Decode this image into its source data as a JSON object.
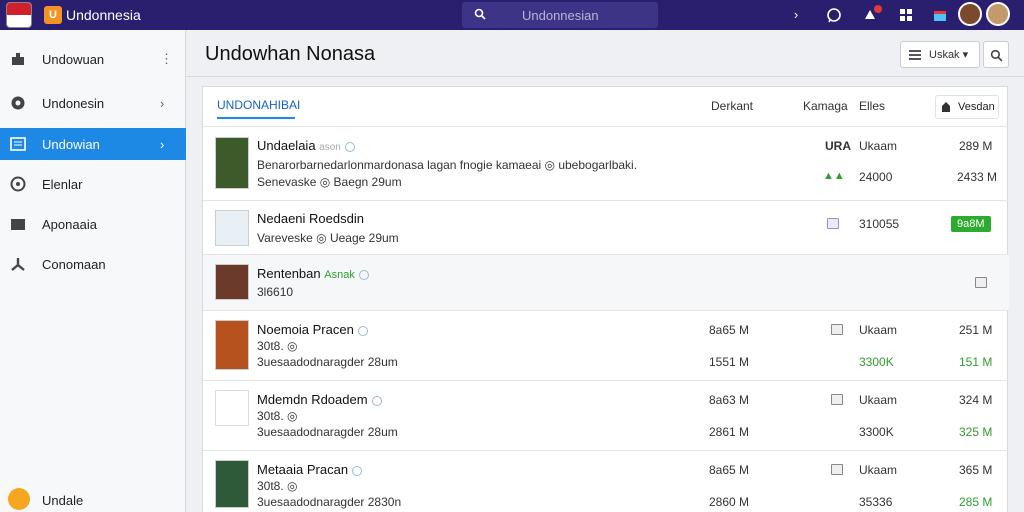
{
  "topbar": {
    "app_title": "Undonnesia",
    "logo_letter": "U",
    "search_text": "Undonnesian"
  },
  "sidebar": {
    "items": [
      {
        "label": "Undowuan",
        "icon": "puzzle-icon",
        "suffix": "⋮"
      },
      {
        "label": "Undonesin",
        "icon": "compass-icon",
        "suffix": "›"
      },
      {
        "label": "Undowian",
        "icon": "list-icon",
        "suffix": "›"
      },
      {
        "label": "Elenlar",
        "icon": "target-icon",
        "suffix": ""
      },
      {
        "label": "Aponaaia",
        "icon": "folder-icon",
        "suffix": ""
      },
      {
        "label": "Conomaan",
        "icon": "tripod-icon",
        "suffix": ""
      }
    ],
    "footer_label": "Undale"
  },
  "header": {
    "title": "Undowhan Nonasa",
    "sort_label": "Uskak ▾"
  },
  "panel": {
    "tab_active": "UNDONAHIBAI",
    "columns": {
      "col1": "Derkant",
      "col2": "Kamaga",
      "col3": "Elles"
    },
    "vendor_button": "Vesdan"
  },
  "rows": [
    {
      "title": "Undaelaia",
      "title_tag": "ason",
      "desc": "Benarorbarnedarlonmardonasa lagan fnogie kamaeai ◎ ubebogarlbaki.",
      "meta": "Senevaske ◎ Baegn 29um",
      "right": {
        "tag": "URA",
        "c1": "Ukaam",
        "c2": "289 M",
        "c3": "24000",
        "c4": "2433 M",
        "arrows": "▲▲"
      }
    },
    {
      "title": "Nedaeni Roedsdin",
      "title_tag": "",
      "meta": "Vareveske ◎ Ueage 29um",
      "right": {
        "c1": "310055",
        "badge": "9a8M"
      }
    },
    {
      "title": "Rentenban",
      "title_tag": "Asnak",
      "meta": "3l6610",
      "right": {}
    },
    {
      "title": "Noemoia Pracen",
      "title_tag": "",
      "meta": "30t8. ◎",
      "meta2": "3uesaadodnaragder 28um",
      "right": {
        "a1": "8a65 M",
        "a2": "1551 M",
        "c1": "Ukaam",
        "c2": "3300K",
        "c3": "251 M",
        "c4": "151 M"
      }
    },
    {
      "title": "Mdemdn Rdoadem",
      "title_tag": "",
      "meta": "30t8. ◎",
      "meta2": "3uesaadodnaragder 28um",
      "right": {
        "a1": "8a63 M",
        "a2": "2861 M",
        "c1": "Ukaam",
        "c2": "3300K",
        "c3": "324 M",
        "c4": "325 M"
      }
    },
    {
      "title": "Metaaia Pracan",
      "title_tag": "",
      "meta": "30t8. ◎",
      "meta2": "3uesaadodnaragder 2830n",
      "right": {
        "a1": "8a65 M",
        "a2": "2860 M",
        "c1": "Ukaam",
        "c2": "35336",
        "c3": "365 M",
        "c4": "285 M"
      }
    }
  ],
  "colors": {
    "accent": "#1e88e5",
    "topbar": "#2a1f6e",
    "green": "#2e9e2e"
  }
}
